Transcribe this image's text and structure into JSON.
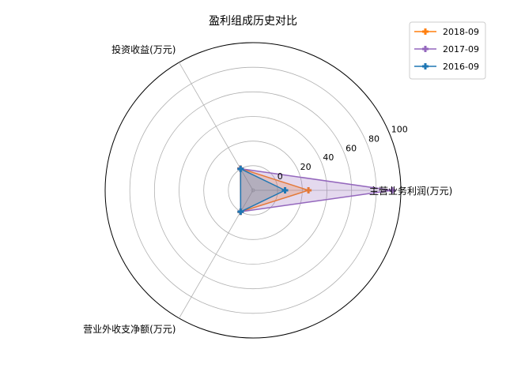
{
  "chart_data": {
    "type": "radar",
    "title": "盈利组成历史对比",
    "axes": [
      "主营业务利润(万元)",
      "投资收益(万元)",
      "营业外收支净额(万元)"
    ],
    "r_ticks": [
      "0",
      "20",
      "40",
      "60",
      "80",
      "100"
    ],
    "r_tick_values": [
      0,
      20,
      40,
      60,
      80,
      100
    ],
    "rlim": [
      -20,
      100
    ],
    "grid": true,
    "legend_position": "top-right",
    "series": [
      {
        "name": "2018-09",
        "color": "#ff7f0e",
        "values": [
          25,
          0.5,
          0.2
        ]
      },
      {
        "name": "2017-09",
        "color": "#9467bd",
        "values": [
          93,
          0.3,
          0.1
        ]
      },
      {
        "name": "2016-09",
        "color": "#1f77b4",
        "values": [
          6,
          0.1,
          0.1
        ]
      }
    ]
  }
}
